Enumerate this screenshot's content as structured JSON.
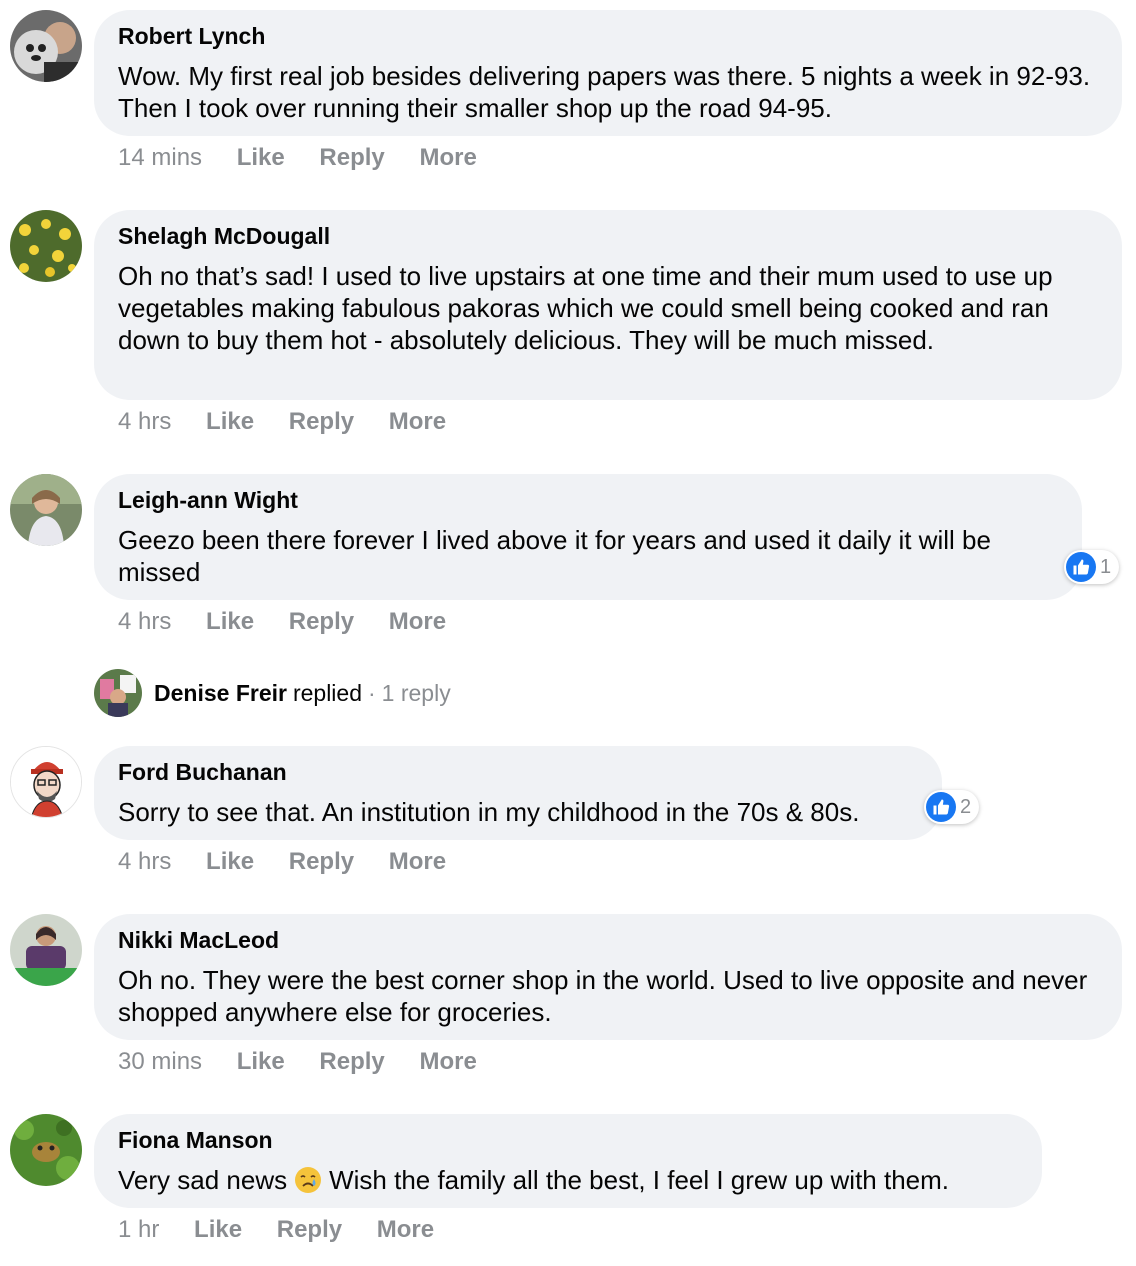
{
  "comments": [
    {
      "author": "Robert Lynch",
      "text": "Wow. My first real job besides delivering papers was there. 5 nights a week in 92-93. Then I took over running their smaller shop up the road 94-95.",
      "time": "14 mins",
      "like": "Like",
      "reply": "Reply",
      "more": "More"
    },
    {
      "author": "Shelagh McDougall",
      "text": "Oh no that’s sad! I used to live upstairs at one time and their mum used to use up vegetables making fabulous pakoras which we could smell being cooked and ran down to buy them hot - absolutely delicious. They will be much missed.",
      "time": "4 hrs",
      "like": "Like",
      "reply": "Reply",
      "more": "More"
    },
    {
      "author": "Leigh-ann Wight",
      "text": "Geezo been there forever I lived above it for years and used it daily it will be missed",
      "time": "4 hrs",
      "like": "Like",
      "reply": "Reply",
      "more": "More",
      "reactions": "1"
    },
    {
      "author": "Ford Buchanan",
      "text": "Sorry to see that. An institution in my childhood in the 70s & 80s.",
      "time": "4 hrs",
      "like": "Like",
      "reply": "Reply",
      "more": "More",
      "reactions": "2"
    },
    {
      "author": "Nikki MacLeod",
      "text": "Oh no. They were the best corner shop in the world. Used to live opposite and never shopped anywhere else for groceries.",
      "time": "30 mins",
      "like": "Like",
      "reply": "Reply",
      "more": "More"
    },
    {
      "author": "Fiona Manson",
      "text_before": "Very sad news",
      "text_after": "Wish the family all the best, I feel I grew up with them.",
      "emoji": "crying-face-icon",
      "time": "1 hr",
      "like": "Like",
      "reply": "Reply",
      "more": "More"
    }
  ],
  "reply_summary": {
    "name": "Denise Freir",
    "verb": "replied",
    "separator": "·",
    "count": "1 reply"
  },
  "colors": {
    "bubble": "#f0f2f5",
    "meta": "#8a8d91",
    "like_blue": "#1877f2"
  }
}
